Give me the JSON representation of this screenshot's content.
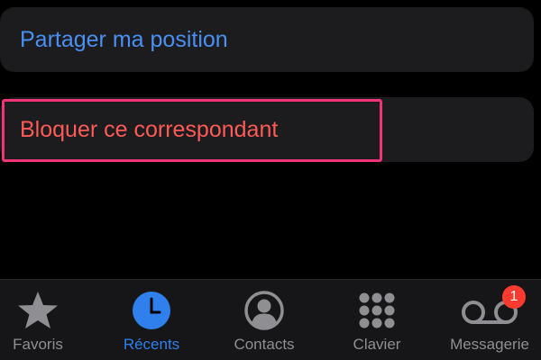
{
  "actions": {
    "share_location": "Partager ma position",
    "block_caller": "Bloquer ce correspondant"
  },
  "tabbar": {
    "tabs": [
      {
        "label": "Favoris",
        "icon": "star-icon",
        "active": false
      },
      {
        "label": "Récents",
        "icon": "clock-icon",
        "active": true
      },
      {
        "label": "Contacts",
        "icon": "person-circle-icon",
        "active": false
      },
      {
        "label": "Clavier",
        "icon": "keypad-icon",
        "active": false
      },
      {
        "label": "Messagerie",
        "icon": "voicemail-icon",
        "active": false,
        "badge": "1"
      }
    ]
  },
  "colors": {
    "background": "#000000",
    "cell_background": "#1c1c1e",
    "link_blue": "#4a90f2",
    "destructive_red": "#ff5a55",
    "highlight_pink": "#f0347a",
    "active_tab": "#2f80ed",
    "inactive_tab": "#8e8e93",
    "badge_red": "#ff3b30"
  }
}
